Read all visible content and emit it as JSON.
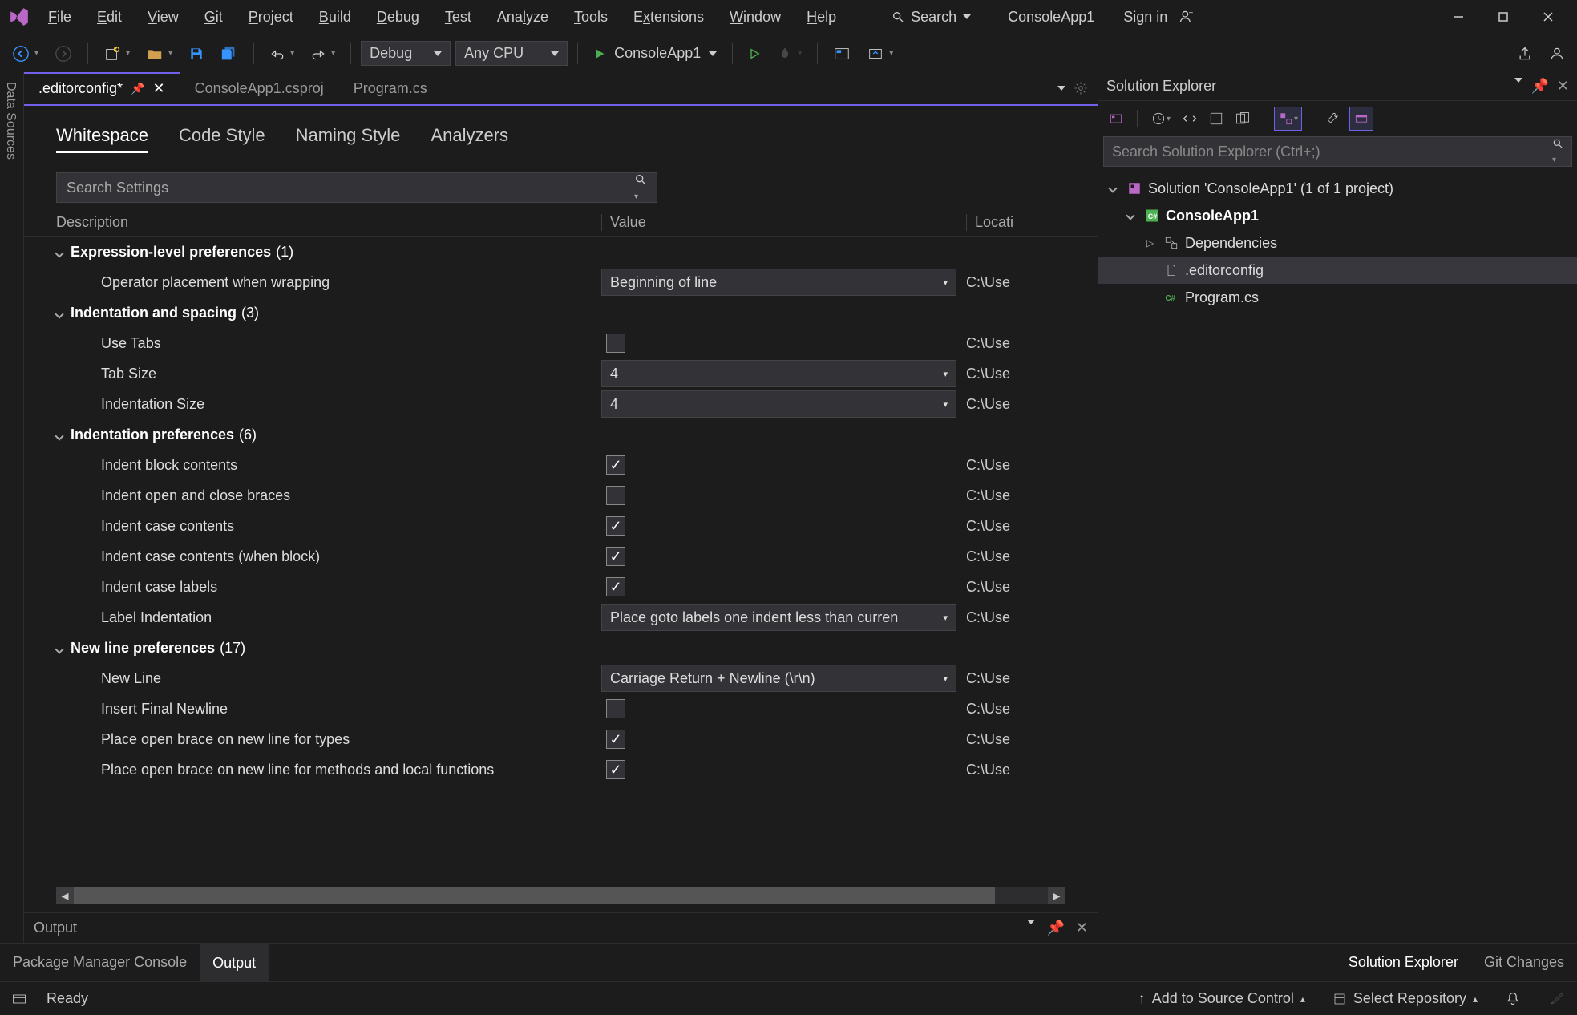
{
  "product": "ConsoleApp1",
  "signin": "Sign in",
  "search_label": "Search",
  "menu": [
    "File",
    "Edit",
    "View",
    "Git",
    "Project",
    "Build",
    "Debug",
    "Test",
    "Analyze",
    "Tools",
    "Extensions",
    "Window",
    "Help"
  ],
  "menu_underline_idx": [
    0,
    0,
    0,
    0,
    0,
    0,
    0,
    0,
    3,
    0,
    1,
    0,
    0
  ],
  "toolbar": {
    "config": "Debug",
    "platform": "Any CPU",
    "start_target": "ConsoleApp1"
  },
  "rail": "Data Sources",
  "doc_tabs": {
    "active": ".editorconfig*",
    "others": [
      "ConsoleApp1.csproj",
      "Program.cs"
    ]
  },
  "settings": {
    "tabs": [
      "Whitespace",
      "Code Style",
      "Naming Style",
      "Analyzers"
    ],
    "active_tab": "Whitespace",
    "search_placeholder": "Search Settings",
    "columns": {
      "desc": "Description",
      "val": "Value",
      "loc": "Locati"
    },
    "loc_truncated": "C:\\Use",
    "groups": [
      {
        "name": "Expression-level preferences",
        "count": "(1)",
        "rows": [
          {
            "desc": "Operator placement when wrapping",
            "type": "dropdown",
            "value": "Beginning of line"
          }
        ]
      },
      {
        "name": "Indentation and spacing",
        "count": "(3)",
        "rows": [
          {
            "desc": "Use Tabs",
            "type": "check",
            "checked": false
          },
          {
            "desc": "Tab Size",
            "type": "dropdown",
            "value": "4"
          },
          {
            "desc": "Indentation Size",
            "type": "dropdown",
            "value": "4"
          }
        ]
      },
      {
        "name": "Indentation preferences",
        "count": "(6)",
        "rows": [
          {
            "desc": "Indent block contents",
            "type": "check",
            "checked": true
          },
          {
            "desc": "Indent open and close braces",
            "type": "check",
            "checked": false
          },
          {
            "desc": "Indent case contents",
            "type": "check",
            "checked": true
          },
          {
            "desc": "Indent case contents (when block)",
            "type": "check",
            "checked": true
          },
          {
            "desc": "Indent case labels",
            "type": "check",
            "checked": true
          },
          {
            "desc": "Label Indentation",
            "type": "dropdown",
            "value": "Place goto labels one indent less than curren"
          }
        ]
      },
      {
        "name": "New line preferences",
        "count": "(17)",
        "rows": [
          {
            "desc": "New Line",
            "type": "dropdown",
            "value": "Carriage Return + Newline (\\r\\n)"
          },
          {
            "desc": "Insert Final Newline",
            "type": "check",
            "checked": false
          },
          {
            "desc": "Place open brace on new line for types",
            "type": "check",
            "checked": true
          },
          {
            "desc": "Place open brace on new line for methods and local functions",
            "type": "check",
            "checked": true
          }
        ]
      }
    ]
  },
  "output_panel": {
    "title": "Output"
  },
  "solution": {
    "title": "Solution Explorer",
    "search_placeholder": "Search Solution Explorer (Ctrl+;)",
    "root": "Solution 'ConsoleApp1' (1 of 1 project)",
    "project": "ConsoleApp1",
    "children": [
      "Dependencies",
      ".editorconfig",
      "Program.cs"
    ]
  },
  "bottom_tabs": {
    "left": [
      "Package Manager Console",
      "Output"
    ],
    "left_active": "Output",
    "right": [
      "Solution Explorer",
      "Git Changes"
    ],
    "right_active": "Solution Explorer"
  },
  "status": {
    "ready": "Ready",
    "source_control": "Add to Source Control",
    "repo": "Select Repository"
  }
}
